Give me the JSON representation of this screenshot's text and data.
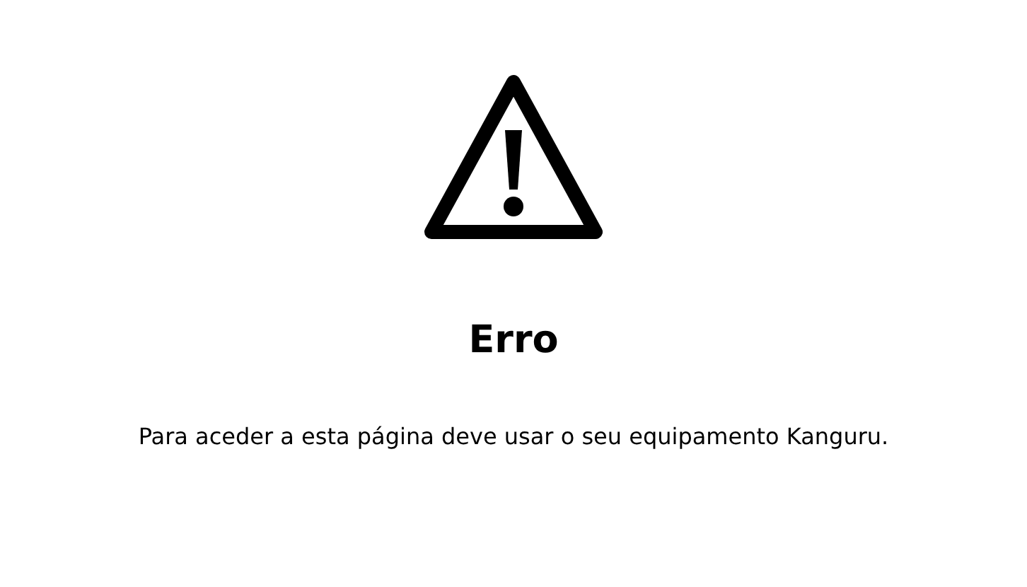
{
  "title": "Erro",
  "message": "Para aceder a esta página deve usar o seu equipamento Kanguru."
}
